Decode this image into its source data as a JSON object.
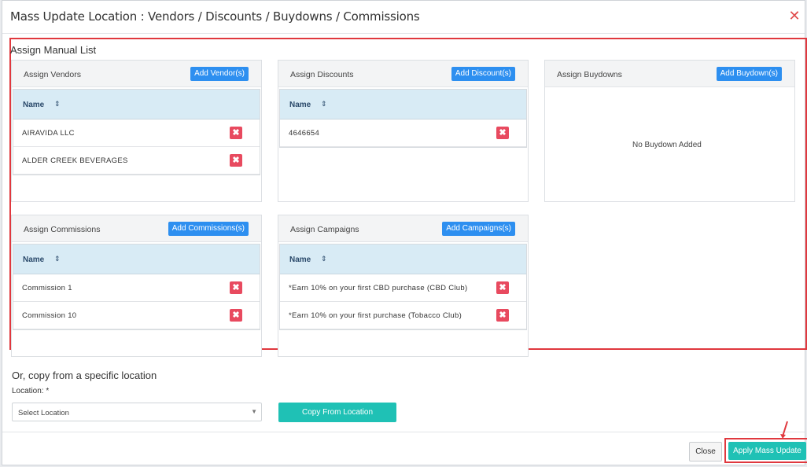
{
  "modal": {
    "title": "Mass Update Location : Vendors / Discounts / Buydowns / Commissions",
    "close_glyph": "✕"
  },
  "manual": {
    "title": "Assign Manual List",
    "column_name": "Name",
    "sort_glyph": "⇕",
    "delete_glyph": "✖"
  },
  "vendors": {
    "title": "Assign Vendors",
    "add_label": "Add Vendor(s)",
    "rows": [
      "AIRAVIDA LLC",
      "ALDER CREEK BEVERAGES"
    ]
  },
  "discounts": {
    "title": "Assign Discounts",
    "add_label": "Add Discount(s)",
    "rows": [
      "4646654"
    ]
  },
  "buydowns": {
    "title": "Assign Buydowns",
    "add_label": "Add Buydown(s)",
    "empty_text": "No Buydown Added"
  },
  "commissions": {
    "title": "Assign Commissions",
    "add_label": "Add Commissions(s)",
    "rows": [
      "Commission 1",
      "Commission 10"
    ]
  },
  "campaigns": {
    "title": "Assign Campaigns",
    "add_label": "Add Campaigns(s)",
    "rows": [
      "*Earn 10% on your first CBD purchase (CBD Club)",
      "*Earn 10% on your first purchase (Tobacco Club)"
    ]
  },
  "copy": {
    "title": "Or, copy from a specific location",
    "location_label": "Location: *",
    "select_value": "Select Location",
    "button_label": "Copy From Location"
  },
  "footer": {
    "close_label": "Close",
    "apply_label": "Apply Mass Update"
  },
  "colors": {
    "primary": "#2d8ff0",
    "teal": "#1fc1b5",
    "danger": "#e84a5f",
    "highlight": "#e0383e",
    "table_header": "#d8ebf5"
  }
}
